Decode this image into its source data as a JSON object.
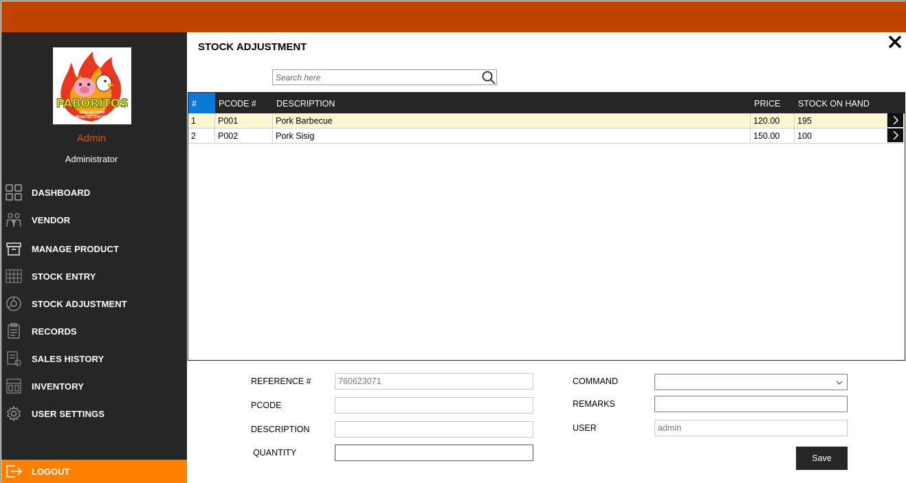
{
  "sidebar": {
    "logo": {
      "brand": "PABORITOS",
      "tagline1": "GRILLED PORK",
      "tagline2": "ROASTED CHICKEN"
    },
    "user_name": "Admin",
    "user_role": "Administrator",
    "items": [
      {
        "label": "DASHBOARD",
        "icon": "dashboard-grid-icon"
      },
      {
        "label": "VENDOR",
        "icon": "vendor-people-icon"
      },
      {
        "label": "MANAGE PRODUCT",
        "icon": "product-box-icon"
      },
      {
        "label": "STOCK ENTRY",
        "icon": "stock-entry-icon"
      },
      {
        "label": "STOCK ADJUSTMENT",
        "icon": "stock-adjustment-icon"
      },
      {
        "label": "RECORDS",
        "icon": "records-clipboard-icon"
      },
      {
        "label": "SALES HISTORY",
        "icon": "sales-history-icon"
      },
      {
        "label": "INVENTORY",
        "icon": "inventory-shelf-icon"
      },
      {
        "label": "USER SETTINGS",
        "icon": "gear-icon"
      }
    ],
    "logout_label": "LOGOUT"
  },
  "main": {
    "title": "STOCK ADJUSTMENT",
    "search": {
      "placeholder": "Search here",
      "value": ""
    },
    "table": {
      "columns": [
        "#",
        "PCODE #",
        "DESCRIPTION",
        "PRICE",
        "STOCK ON HAND"
      ],
      "rows": [
        {
          "num": "1",
          "pcode": "P001",
          "description": "Pork Barbecue",
          "price": "120.00",
          "stock": "195",
          "selected": true
        },
        {
          "num": "2",
          "pcode": "P002",
          "description": "Pork Sisig",
          "price": "150.00",
          "stock": "100",
          "selected": false
        }
      ]
    },
    "form": {
      "reference_label": "REFERENCE #",
      "reference_value": "760623071",
      "pcode_label": "PCODE",
      "pcode_value": "",
      "description_label": "DESCRIPTION",
      "description_value": "",
      "quantity_label": "QUANTITY",
      "quantity_value": "",
      "command_label": "COMMAND",
      "command_value": "",
      "remarks_label": "REMARKS",
      "remarks_value": "",
      "user_label": "USER",
      "user_value": "admin",
      "save_label": "Save"
    }
  },
  "colors": {
    "topbar": "#c14300",
    "sidebar": "#262626",
    "accent_orange": "#ff7f00",
    "user_name": "#d9531e",
    "selected_row": "#fdf6d2",
    "header_index_cell": "#0a78d7"
  }
}
